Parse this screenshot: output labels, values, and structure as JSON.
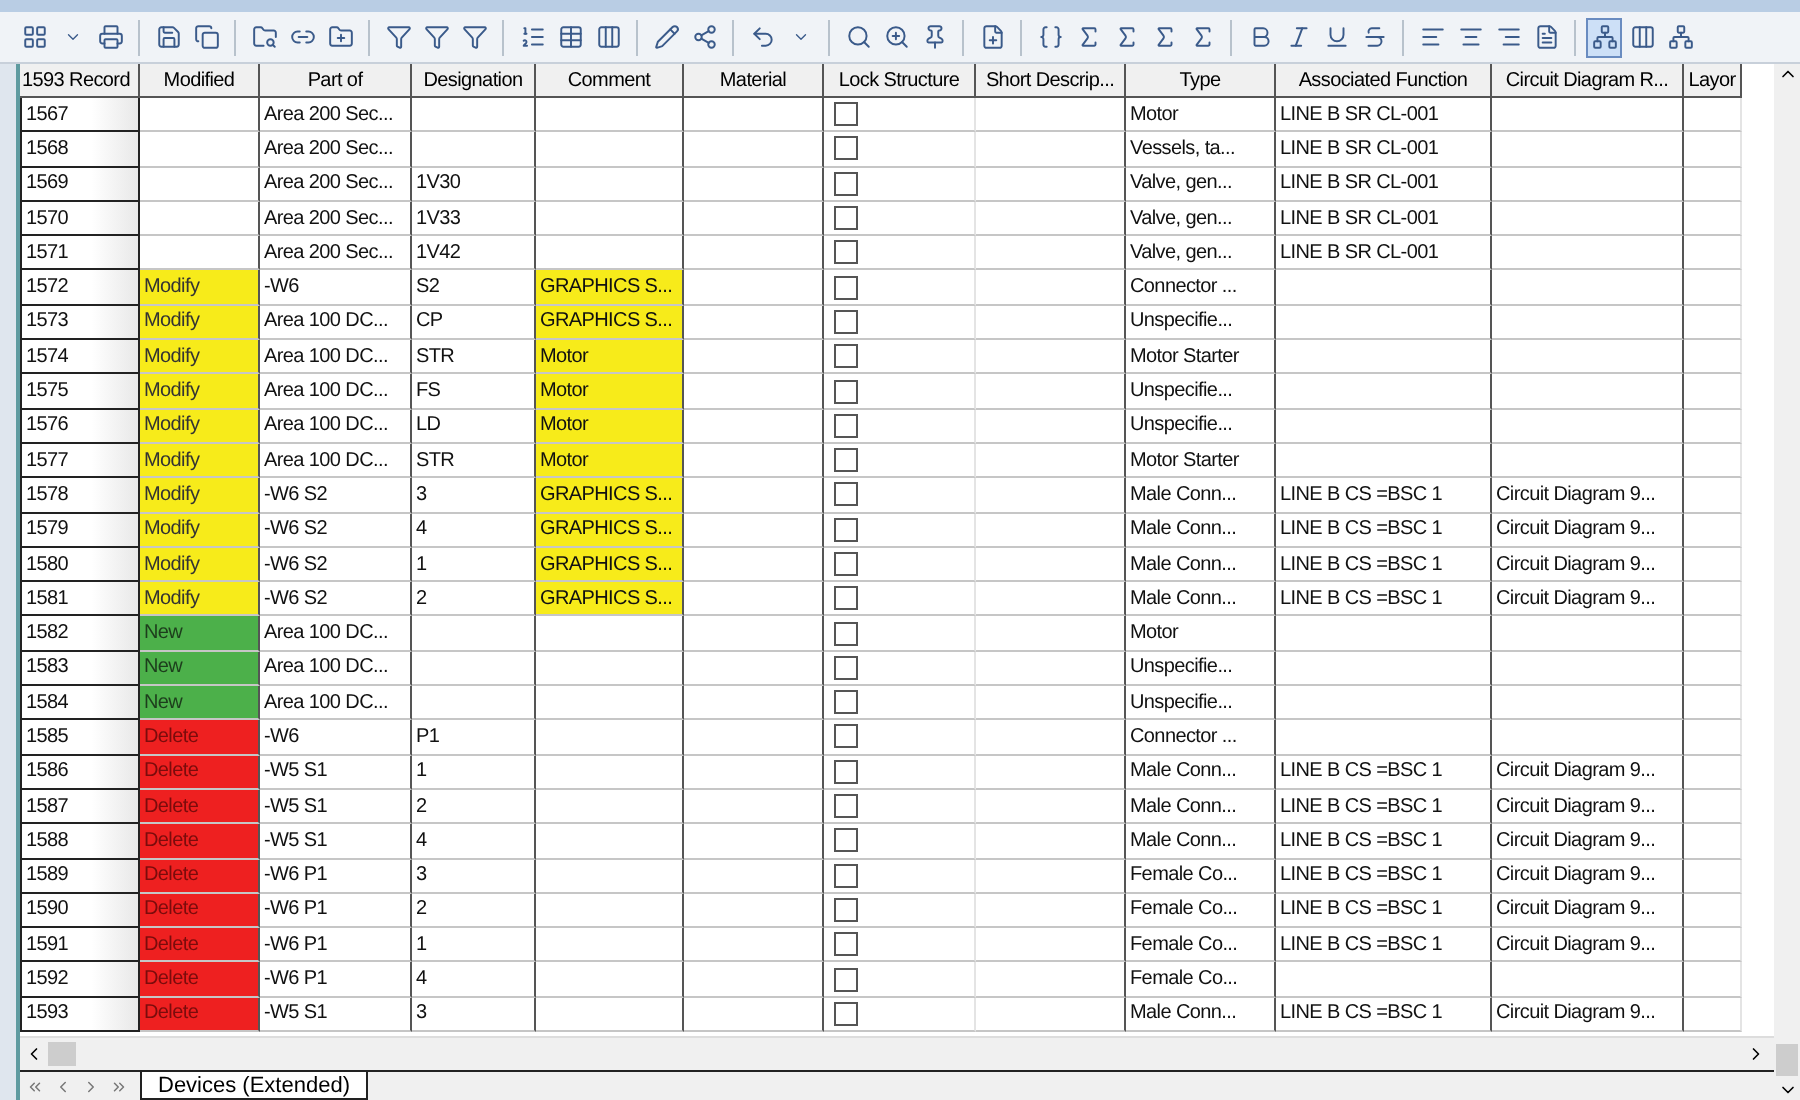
{
  "table": {
    "columns": [
      "1593 Record",
      "Modified",
      "Part of",
      "Designation",
      "Comment",
      "Material",
      "Lock Structure",
      "Short Descrip...",
      "Type",
      "Associated Function",
      "Circuit Diagram R...",
      "Layor"
    ],
    "rows": [
      {
        "record": "1567",
        "modified": {
          "kind": "none"
        },
        "part_of": "Area 200 Sec...",
        "comment": {
          "changed": false
        },
        "locked": false,
        "type": "Motor",
        "function": "LINE B SR CL-001"
      },
      {
        "record": "1568",
        "modified": {
          "kind": "none"
        },
        "part_of": "Area 200 Sec...",
        "comment": {
          "changed": false
        },
        "locked": false,
        "type": "Vessels, ta...",
        "function": "LINE B SR CL-001"
      },
      {
        "record": "1569",
        "modified": {
          "kind": "none"
        },
        "part_of": "Area 200 Sec...",
        "designation": "1V30",
        "comment": {
          "changed": false
        },
        "locked": false,
        "type": "Valve, gen...",
        "function": "LINE B SR CL-001"
      },
      {
        "record": "1570",
        "modified": {
          "kind": "none"
        },
        "part_of": "Area 200 Sec...",
        "designation": "1V33",
        "comment": {
          "changed": false
        },
        "locked": false,
        "type": "Valve, gen...",
        "function": "LINE B SR CL-001"
      },
      {
        "record": "1571",
        "modified": {
          "kind": "none"
        },
        "part_of": "Area 200 Sec...",
        "designation": "1V42",
        "comment": {
          "changed": false
        },
        "locked": false,
        "type": "Valve, gen...",
        "function": "LINE B SR CL-001"
      },
      {
        "record": "1572",
        "modified": {
          "kind": "modify",
          "text": "Modify"
        },
        "part_of": "-W6",
        "designation": "S2",
        "comment": {
          "text": "GRAPHICS S...",
          "changed": true
        },
        "locked": false,
        "type": "Connector ..."
      },
      {
        "record": "1573",
        "modified": {
          "kind": "modify",
          "text": "Modify"
        },
        "part_of": "Area 100 DC...",
        "designation": "CP",
        "comment": {
          "text": "GRAPHICS S...",
          "changed": true
        },
        "locked": false,
        "type": "Unspecifie..."
      },
      {
        "record": "1574",
        "modified": {
          "kind": "modify",
          "text": "Modify"
        },
        "part_of": "Area 100 DC...",
        "designation": "STR",
        "comment": {
          "text": "Motor",
          "changed": true
        },
        "locked": false,
        "type": "Motor Starter"
      },
      {
        "record": "1575",
        "modified": {
          "kind": "modify",
          "text": "Modify"
        },
        "part_of": "Area 100 DC...",
        "designation": "FS",
        "comment": {
          "text": "Motor",
          "changed": true
        },
        "locked": false,
        "type": "Unspecifie..."
      },
      {
        "record": "1576",
        "modified": {
          "kind": "modify",
          "text": "Modify"
        },
        "part_of": "Area 100 DC...",
        "designation": "LD",
        "comment": {
          "text": "Motor",
          "changed": true
        },
        "locked": false,
        "type": "Unspecifie..."
      },
      {
        "record": "1577",
        "modified": {
          "kind": "modify",
          "text": "Modify"
        },
        "part_of": "Area 100 DC...",
        "designation": "STR",
        "comment": {
          "text": "Motor",
          "changed": true
        },
        "locked": false,
        "type": "Motor Starter"
      },
      {
        "record": "1578",
        "modified": {
          "kind": "modify",
          "text": "Modify"
        },
        "part_of": "-W6 S2",
        "designation": "3",
        "comment": {
          "text": "GRAPHICS S...",
          "changed": true
        },
        "locked": false,
        "type": "Male Conn...",
        "function": "LINE B CS =BSC 1",
        "diagram": "Circuit Diagram 9..."
      },
      {
        "record": "1579",
        "modified": {
          "kind": "modify",
          "text": "Modify"
        },
        "part_of": "-W6 S2",
        "designation": "4",
        "comment": {
          "text": "GRAPHICS S...",
          "changed": true
        },
        "locked": false,
        "type": "Male Conn...",
        "function": "LINE B CS =BSC 1",
        "diagram": "Circuit Diagram 9..."
      },
      {
        "record": "1580",
        "modified": {
          "kind": "modify",
          "text": "Modify"
        },
        "part_of": "-W6 S2",
        "designation": "1",
        "comment": {
          "text": "GRAPHICS S...",
          "changed": true
        },
        "locked": false,
        "type": "Male Conn...",
        "function": "LINE B CS =BSC 1",
        "diagram": "Circuit Diagram 9..."
      },
      {
        "record": "1581",
        "modified": {
          "kind": "modify",
          "text": "Modify"
        },
        "part_of": "-W6 S2",
        "designation": "2",
        "comment": {
          "text": "GRAPHICS S...",
          "changed": true
        },
        "locked": false,
        "type": "Male Conn...",
        "function": "LINE B CS =BSC 1",
        "diagram": "Circuit Diagram 9..."
      },
      {
        "record": "1582",
        "modified": {
          "kind": "new",
          "text": "New"
        },
        "part_of": "Area 100 DC...",
        "comment": {
          "changed": false
        },
        "locked": false,
        "type": "Motor"
      },
      {
        "record": "1583",
        "modified": {
          "kind": "new",
          "text": "New"
        },
        "part_of": "Area 100 DC...",
        "comment": {
          "changed": false
        },
        "locked": false,
        "type": "Unspecifie..."
      },
      {
        "record": "1584",
        "modified": {
          "kind": "new",
          "text": "New"
        },
        "part_of": "Area 100 DC...",
        "comment": {
          "changed": false
        },
        "locked": false,
        "type": "Unspecifie..."
      },
      {
        "record": "1585",
        "modified": {
          "kind": "delete",
          "text": "Delete"
        },
        "part_of": "-W6",
        "designation": "P1",
        "comment": {
          "changed": false
        },
        "locked": false,
        "type": "Connector ..."
      },
      {
        "record": "1586",
        "modified": {
          "kind": "delete",
          "text": "Delete"
        },
        "part_of": "-W5 S1",
        "designation": "1",
        "comment": {
          "changed": false
        },
        "locked": false,
        "type": "Male Conn...",
        "function": "LINE B CS =BSC 1",
        "diagram": "Circuit Diagram 9..."
      },
      {
        "record": "1587",
        "modified": {
          "kind": "delete",
          "text": "Delete"
        },
        "part_of": "-W5 S1",
        "designation": "2",
        "comment": {
          "changed": false
        },
        "locked": false,
        "type": "Male Conn...",
        "function": "LINE B CS =BSC 1",
        "diagram": "Circuit Diagram 9..."
      },
      {
        "record": "1588",
        "modified": {
          "kind": "delete",
          "text": "Delete"
        },
        "part_of": "-W5 S1",
        "designation": "4",
        "comment": {
          "changed": false
        },
        "locked": false,
        "type": "Male Conn...",
        "function": "LINE B CS =BSC 1",
        "diagram": "Circuit Diagram 9..."
      },
      {
        "record": "1589",
        "modified": {
          "kind": "delete",
          "text": "Delete"
        },
        "part_of": "-W6 P1",
        "designation": "3",
        "comment": {
          "changed": false
        },
        "locked": false,
        "type": "Female Co...",
        "function": "LINE B CS =BSC 1",
        "diagram": "Circuit Diagram 9..."
      },
      {
        "record": "1590",
        "modified": {
          "kind": "delete",
          "text": "Delete"
        },
        "part_of": "-W6 P1",
        "designation": "2",
        "comment": {
          "changed": false
        },
        "locked": false,
        "type": "Female Co...",
        "function": "LINE B CS =BSC 1",
        "diagram": "Circuit Diagram 9..."
      },
      {
        "record": "1591",
        "modified": {
          "kind": "delete",
          "text": "Delete"
        },
        "part_of": "-W6 P1",
        "designation": "1",
        "comment": {
          "changed": false
        },
        "locked": false,
        "type": "Female Co...",
        "function": "LINE B CS =BSC 1",
        "diagram": "Circuit Diagram 9..."
      },
      {
        "record": "1592",
        "modified": {
          "kind": "delete",
          "text": "Delete"
        },
        "part_of": "-W6 P1",
        "designation": "4",
        "comment": {
          "changed": false
        },
        "locked": false,
        "type": "Female Co..."
      },
      {
        "record": "1593",
        "modified": {
          "kind": "delete",
          "text": "Delete"
        },
        "part_of": "-W5 S1",
        "designation": "3",
        "comment": {
          "changed": false
        },
        "locked": false,
        "type": "Male Conn...",
        "function": "LINE B CS =BSC 1",
        "diagram": "Circuit Diagram 9..."
      }
    ]
  },
  "sheet_tabs": [
    {
      "label": "Devices (Extended)",
      "selected": true
    }
  ]
}
